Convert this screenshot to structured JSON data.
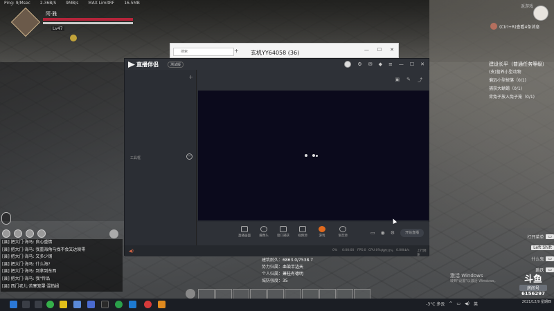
{
  "game": {
    "perf": [
      "Ping: 9/Msec",
      "2.36B/S",
      "9MB/s",
      "MAX LimitRF",
      "16.5MB"
    ],
    "player": {
      "name": "阿·雅",
      "level": "Lv47"
    },
    "corner_link": "返游戏",
    "esc_hint": "(Ctrl+R)查看4条消息",
    "quests": {
      "title": "建设长平（普通任务等级）",
      "items": [
        "(支)营养小型动物",
        "偏远小型掉落（0/1)",
        "捕获大蜥蜴（0/1)",
        "背兔子放入兔子笼（0/1)"
      ]
    },
    "chat": [
      "[县] 把大门·海马: 良心重情",
      "[县] 把大门·海马: 我重海角马找不会又达映零",
      "[县] 把大门·海马: 又多少钢",
      "[县] 把大门·海马: 什么海?",
      "[县] 把大门·海马: 到拿到东西",
      "[县] 把大门·海马: 我\"传品",
      "[县] 西门老儿·苦寒笼罩·混热损"
    ],
    "stats": [
      {
        "label": "建筑耐久：",
        "value": "6863.0/7538.7"
      },
      {
        "label": "势力归属：",
        "value": "血染半边天"
      },
      {
        "label": "个人归属：",
        "value": "萧桂有德明"
      },
      {
        "label": "城防强度：",
        "value": "35"
      }
    ],
    "keys": [
      {
        "label": "打开菜单",
        "key": ""
      },
      {
        "label": "Left Shift",
        "key": ""
      },
      {
        "label": "什么鬼",
        "key": ""
      },
      {
        "label": "跳跃",
        "key": ""
      }
    ]
  },
  "browser": {
    "tab_label": "搜索",
    "window_title": "玄机YY64058 (36)",
    "controls": [
      "—",
      "☐",
      "✕"
    ]
  },
  "live_app": {
    "title": "直播伴侣",
    "version": "测试版",
    "sidebar_label": "工具框",
    "controls": [
      {
        "id": "screen",
        "label": "直播画面"
      },
      {
        "id": "camera",
        "label": "摄像头"
      },
      {
        "id": "window",
        "label": "窗口捕获"
      },
      {
        "id": "video",
        "label": "视频源"
      },
      {
        "id": "game",
        "label": "游戏"
      },
      {
        "id": "voice",
        "label": "语音源"
      }
    ],
    "go_live": "开始直播",
    "status": [
      "0%",
      "0:00:00",
      "FPS:0",
      "CPU:0%",
      "内存:0%",
      "0.00kb/s",
      "帧率",
      "帧率出"
    ],
    "status_right": "上行网速"
  },
  "windows_watermark": {
    "title": "激活 Windows",
    "sub": "转到\"设置\"以激活 Windows。"
  },
  "douyu": {
    "brand": "斗鱼",
    "room_label": "房间号",
    "room": "6156297"
  },
  "taskbar": {
    "weather": "-3°C 多云",
    "time": "",
    "date": "2021/12/9 星期四",
    "lang": "英"
  }
}
